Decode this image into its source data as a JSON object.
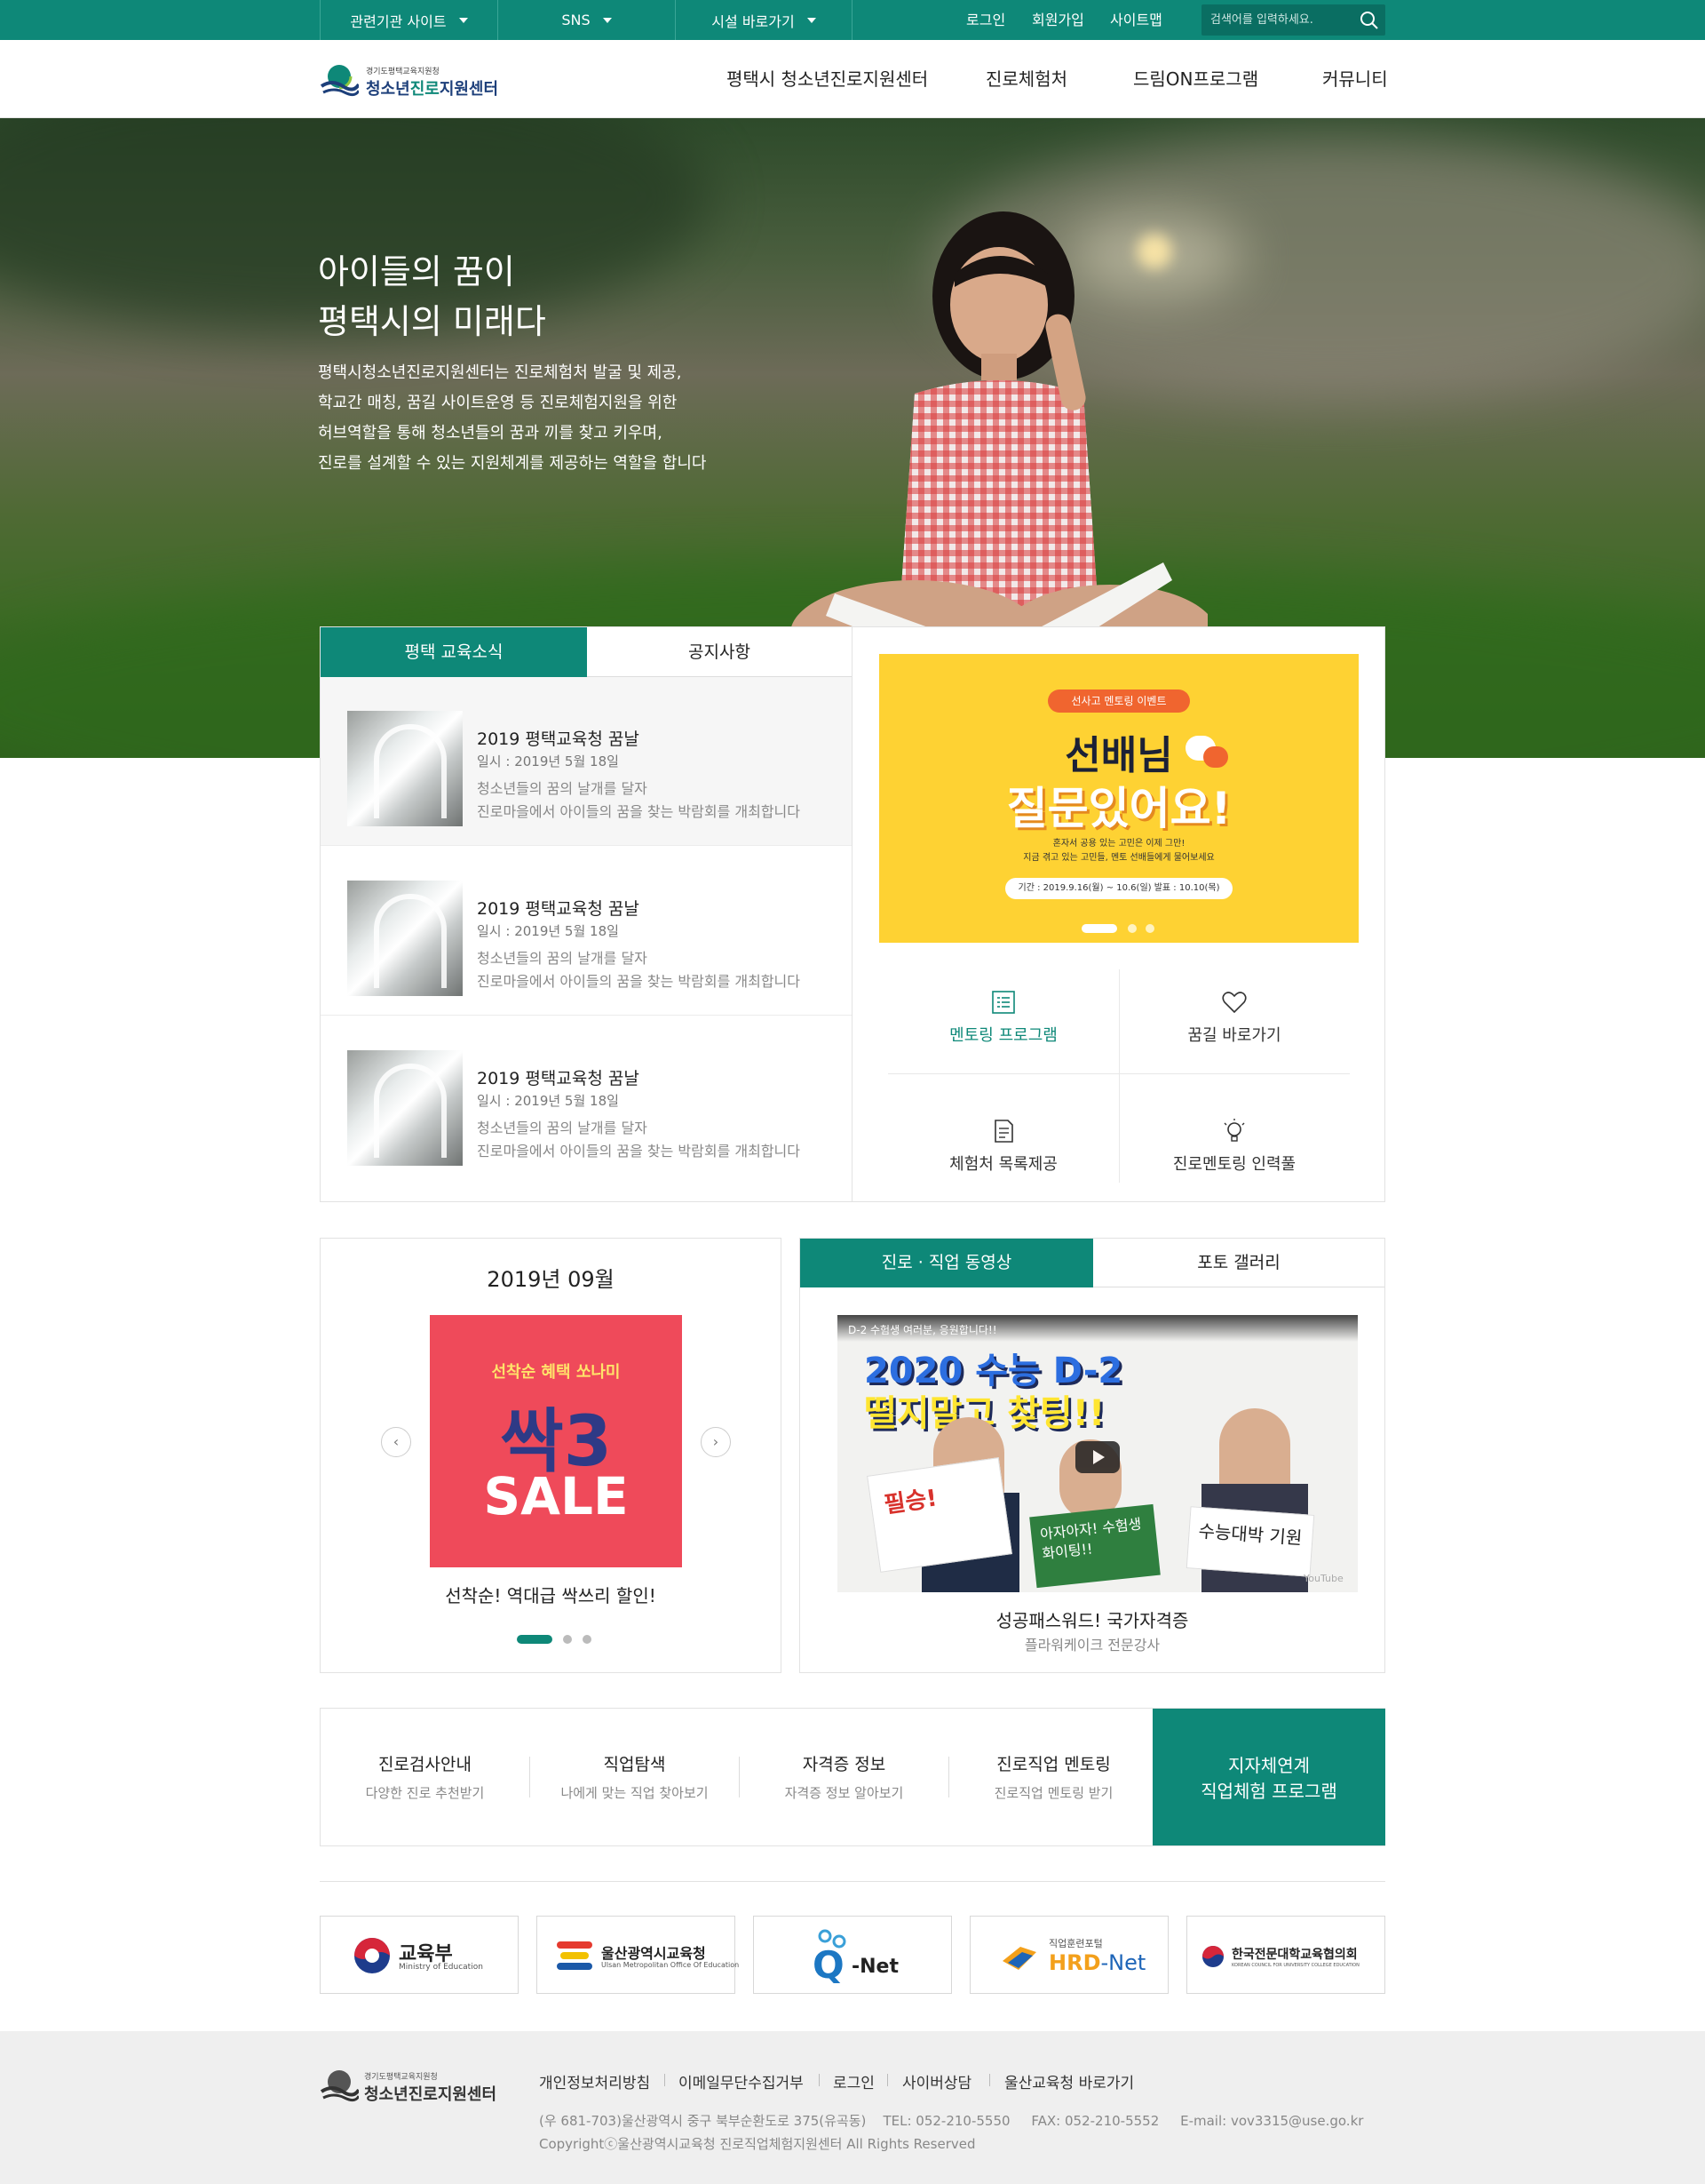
{
  "topbar": {
    "dropdowns": [
      "관련기관 사이트",
      "SNS",
      "시설 바로가기"
    ],
    "links": [
      "로그인",
      "회원가입",
      "사이트맵"
    ],
    "search_placeholder": "검색어를 입력하세요."
  },
  "logo": {
    "small": "경기도평택교육지원청",
    "main_a": "청소년",
    "main_b": "진로",
    "main_c": "지원센터"
  },
  "nav": [
    "평택시 청소년진로지원센터",
    "진로체험처",
    "드림ON프로그램",
    "커뮤니티"
  ],
  "hero": {
    "title_line1": "아이들의 꿈이",
    "title_line2": "평택시의 미래다",
    "desc": [
      "평택시청소년진로지원센터는 진로체험처 발굴 및 제공,",
      "학교간 매칭, 꿈길 사이트운영 등 진로체험지원을 위한",
      "허브역할을 통해 청소년들의 꿈과 끼를 찾고 키우며,",
      "진로를 설계할 수 있는 지원체계를 제공하는 역할을 합니다"
    ]
  },
  "news": {
    "tabs": [
      "평택 교육소식",
      "공지사항"
    ],
    "items": [
      {
        "title": "2019 평택교육청 꿈날",
        "date": "일시 : 2019년 5월 18일",
        "desc1": "청소년들의 꿈의 날개를 달자",
        "desc2": "진로마을에서 아이들의 꿈을 찾는 박람회를 개최합니다"
      },
      {
        "title": "2019 평택교육청 꿈날",
        "date": "일시 : 2019년 5월 18일",
        "desc1": "청소년들의 꿈의 날개를 달자",
        "desc2": "진로마을에서 아이들의 꿈을 찾는 박람회를 개최합니다"
      },
      {
        "title": "2019 평택교육청 꿈날",
        "date": "일시 : 2019년 5월 18일",
        "desc1": "청소년들의 꿈의 날개를 달자",
        "desc2": "진로마을에서 아이들의 꿈을 찾는 박람회를 개최합니다"
      }
    ]
  },
  "banner": {
    "badge": "선사고 멘토링 이벤트",
    "line1": "선배님",
    "line2": "질문있어요!",
    "sub1": "혼자서 공용 있는 고민은 이제 그만!",
    "sub2": "지금 겪고 있는 고민들, 멘토 선배들에게 물어보세요",
    "period": "기간 : 2019.9.16(월) ~ 10.6(일)   발표 : 10.10(목)"
  },
  "quick_links": [
    "멘토링 프로그램",
    "꿈길 바로가기",
    "체험처 목록제공",
    "진로멘토링 인력풀"
  ],
  "calendar": {
    "month": "2019년 09월",
    "promo_top": "선착순 혜택 쏘나미",
    "promo_big": "싹3",
    "promo_sale": "SALE",
    "caption": "선착순! 역대급 싹쓰리 할인!"
  },
  "video": {
    "tabs": [
      "진로 · 직업 동영상",
      "포토 갤러리"
    ],
    "video_title": "D-2 수험생 여러분, 응원합니다!!",
    "headline1": "2020 수능 D-2",
    "headline2": "떨지말고 찾팅!!",
    "sign1": "필승!",
    "sign2": "아자아자! 수험생 화이팅!!",
    "sign3": "수능대박 기원",
    "youtube": "YouTube",
    "caption": "성공패스워드! 국가자격증",
    "sub": "플라워케이크 전문강사"
  },
  "services": [
    {
      "title": "진로검사안내",
      "sub": "다양한 진로 추천받기"
    },
    {
      "title": "직업탐색",
      "sub": "나에게 맞는 직업 찾아보기"
    },
    {
      "title": "자격증 정보",
      "sub": "자격증 정보 알아보기"
    },
    {
      "title": "진로직업 멘토링",
      "sub": "진로직업 멘토링 받기"
    }
  ],
  "service_highlight": {
    "line1": "지자체연계",
    "line2": "직업체험 프로그램"
  },
  "partners": {
    "moe": {
      "name": "교육부",
      "en": "Ministry of Education"
    },
    "ulsan": {
      "name": "울산광역시교육청",
      "en": "Ulsan Metropolitan Office Of Education"
    },
    "qnet": {
      "q": "Q",
      "net": "-Net"
    },
    "hrd": {
      "small": "직업훈련포털",
      "hrd": "HRD",
      "net": "-Net"
    },
    "kcue": {
      "name": "한국전문대학교육협의회",
      "en": "KOREAN COUNCIL FOR UNIVERSITY COLLEGE EDUCATION"
    }
  },
  "footer": {
    "links": [
      "개인정보처리방침",
      "이메일무단수집거부",
      "로그인",
      "사이버상담",
      "울산교육청 바로가기"
    ],
    "address": "(우 681-703)울산광역시 중구 북부순환도로 375(유곡동)    TEL: 052-210-5550     FAX: 052-210-5552     E-mail: vov3315@use.go.kr",
    "copyright": "Copyrightⓒ울산광역시교육청 진로직업체험지원센터 All Rights Reserved"
  },
  "colors": {
    "primary": "#0e8878",
    "banner_yellow": "#fed233",
    "promo_red": "#ef4a5a"
  }
}
